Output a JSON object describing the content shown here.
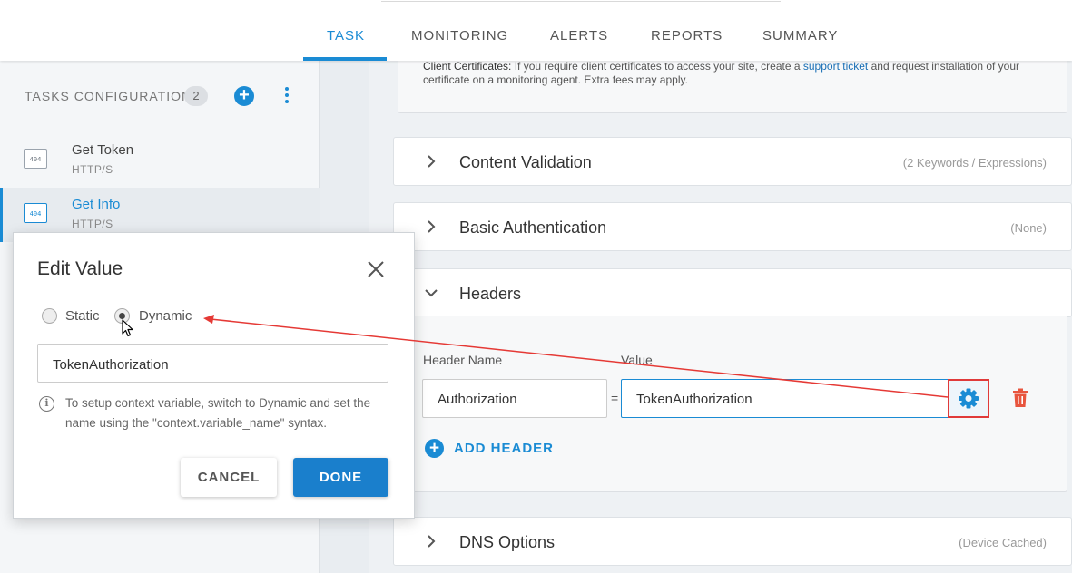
{
  "tabs": [
    {
      "label": "TASK",
      "active": true
    },
    {
      "label": "MONITORING",
      "active": false
    },
    {
      "label": "ALERTS",
      "active": false
    },
    {
      "label": "REPORTS",
      "active": false
    },
    {
      "label": "SUMMARY",
      "active": false
    }
  ],
  "sidebar": {
    "header": "TASKS CONFIGURATION",
    "count": "2",
    "add_icon": "plus-circle-icon",
    "more_icon": "vertical-ellipsis-icon",
    "tasks": [
      {
        "name": "Get Token",
        "type": "HTTP/S",
        "icon_text": "404",
        "selected": false
      },
      {
        "name": "Get Info",
        "type": "HTTP/S",
        "icon_text": "404",
        "selected": true
      }
    ]
  },
  "main": {
    "cert_notice": {
      "label": "Client Certificates:",
      "text_before": "If you require client certificates to access your site, create a",
      "link": "support ticket",
      "text_after": "and request installation of your certificate on a monitoring agent. Extra fees may apply."
    },
    "panels": {
      "content_validation": {
        "title": "Content Validation",
        "meta": "(2 Keywords / Expressions)"
      },
      "basic_auth": {
        "title": "Basic Authentication",
        "meta": "(None)"
      },
      "headers": {
        "title": "Headers"
      },
      "dns": {
        "title": "DNS Options",
        "meta": "(Device Cached)"
      }
    },
    "headers_form": {
      "name_label": "Header Name",
      "value_label": "Value",
      "name_value": "Authorization",
      "equals": "=",
      "value_value": "TokenAuthorization",
      "add_label": "ADD HEADER"
    }
  },
  "modal": {
    "title": "Edit Value",
    "radio_static": "Static",
    "radio_dynamic": "Dynamic",
    "selected": "Dynamic",
    "input_value": "TokenAuthorization",
    "info_text": "To setup context variable, switch to Dynamic and set the name using the \"context.variable_name\" syntax.",
    "cancel_label": "CANCEL",
    "done_label": "DONE"
  },
  "colors": {
    "accent": "#1a8bd4",
    "highlight": "#e03a3a",
    "danger": "#e8553e"
  }
}
